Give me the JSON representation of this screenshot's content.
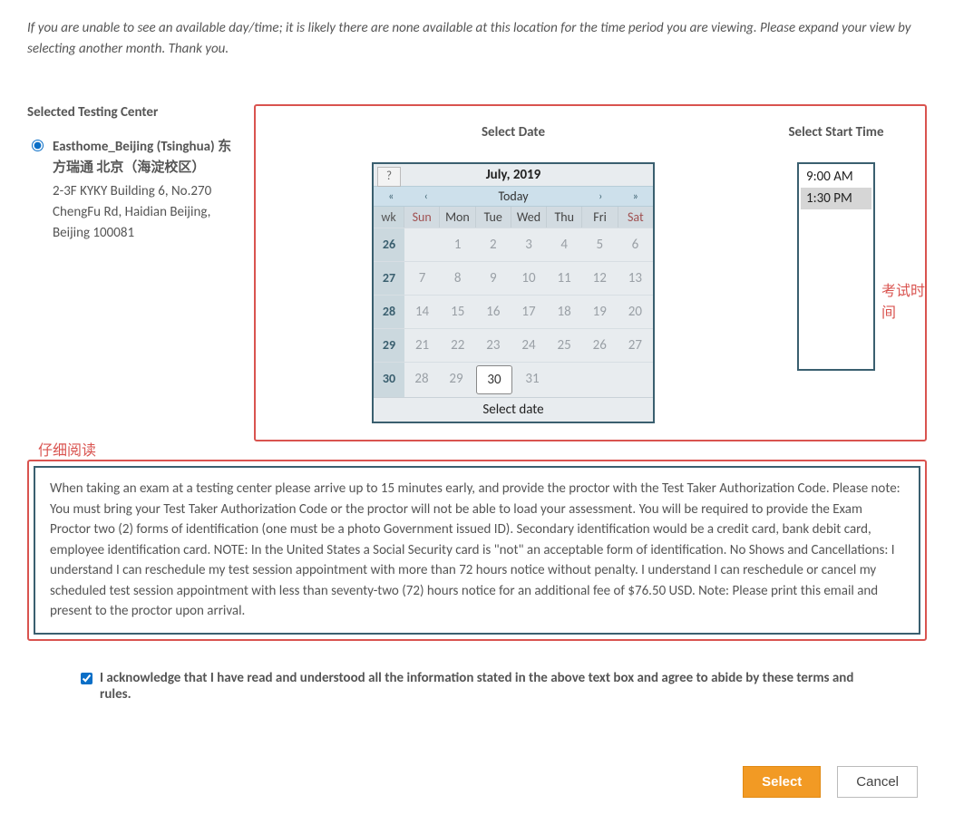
{
  "notice": "If you are unable to see an available day/time; it is likely there are none available at this location for the time period you are viewing. Please expand your view by selecting another month. Thank you.",
  "center": {
    "title": "Selected Testing Center",
    "name": "Easthome_Beijing (Tsinghua) 东方瑞通 北京（海淀校区）",
    "address": "2-3F KYKY Building 6, No.270 ChengFu Rd, Haidian\nBeijing, Beijing 100081"
  },
  "date": {
    "title": "Select Date",
    "month_label": "July, 2019",
    "today_label": "Today",
    "footer": "Select date",
    "help": "?",
    "nav": {
      "first": "«",
      "prev": "‹",
      "next": "›",
      "last": "»"
    },
    "wk_header": "wk",
    "dow": [
      "Sun",
      "Mon",
      "Tue",
      "Wed",
      "Thu",
      "Fri",
      "Sat"
    ],
    "weeks": [
      {
        "wk": "26",
        "days": [
          "",
          "1",
          "2",
          "3",
          "4",
          "5",
          "6"
        ]
      },
      {
        "wk": "27",
        "days": [
          "7",
          "8",
          "9",
          "10",
          "11",
          "12",
          "13"
        ]
      },
      {
        "wk": "28",
        "days": [
          "14",
          "15",
          "16",
          "17",
          "18",
          "19",
          "20"
        ]
      },
      {
        "wk": "29",
        "days": [
          "21",
          "22",
          "23",
          "24",
          "25",
          "26",
          "27"
        ]
      },
      {
        "wk": "30",
        "days": [
          "28",
          "29",
          "30",
          "31",
          "",
          "",
          ""
        ]
      }
    ],
    "today_value": "30"
  },
  "time": {
    "title": "Select Start Time",
    "options": [
      "9:00 AM",
      "1:30 PM"
    ],
    "selected": "1:30 PM"
  },
  "annotations": {
    "exam_time": "考试时间",
    "read_carefully": "仔细阅读"
  },
  "policy": "When taking an exam at a testing center please arrive up to 15 minutes early, and provide the proctor with the Test Taker Authorization Code. Please note: You must bring your Test Taker Authorization Code or the proctor will not be able to load your assessment. You will be required to provide the Exam Proctor two (2) forms of identification (one must be a photo Government issued ID). Secondary identification would be a credit card, bank debit card, employee identification card. NOTE: In the United States a Social Security card is \"not\" an acceptable form of identification. No Shows and Cancellations: I understand I can reschedule my test session appointment with more than 72 hours notice without penalty. I understand I can reschedule or cancel my scheduled test session appointment with less than seventy-two (72) hours notice for an additional fee of $76.50 USD. Note: Please print this email and present to the proctor upon arrival.",
  "ack": "I acknowledge that I have read and understood all the information stated in the above text box and agree to abide by these terms and rules.",
  "buttons": {
    "select": "Select",
    "cancel": "Cancel"
  }
}
